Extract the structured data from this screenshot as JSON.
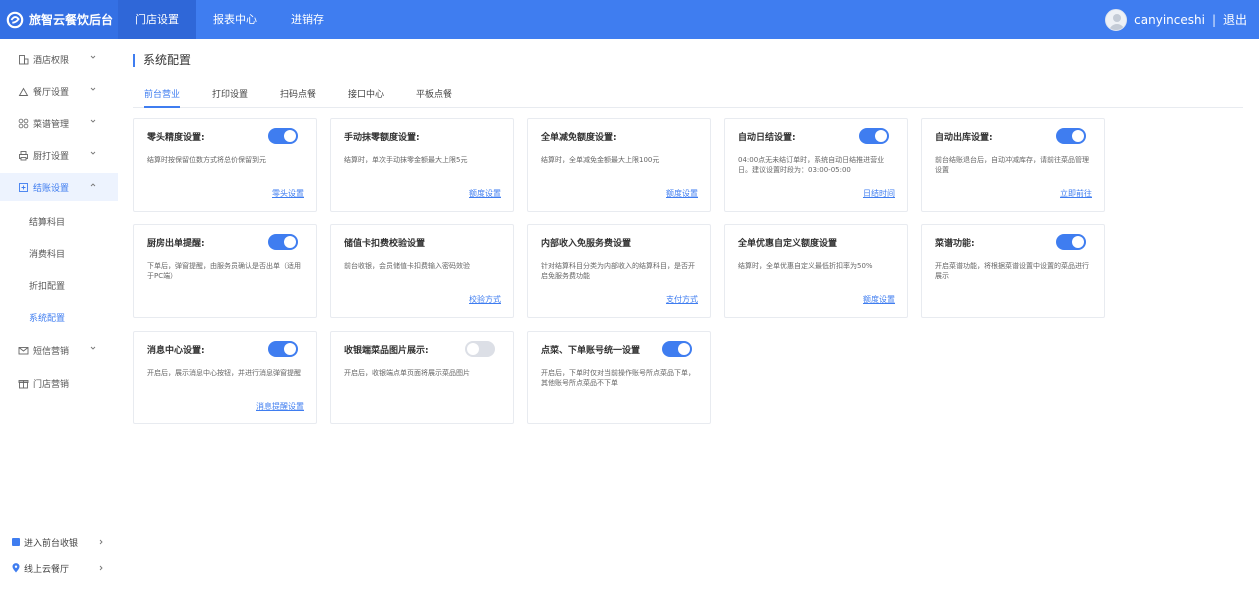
{
  "brand": {
    "name": "旅智云餐饮后台"
  },
  "top_nav": [
    "门店设置",
    "报表中心",
    "进销存"
  ],
  "user": {
    "name": "canyinceshi",
    "separator": "|",
    "logout": "退出"
  },
  "sidebar": {
    "groups": [
      {
        "label": "酒店权限",
        "icon": "building-icon"
      },
      {
        "label": "餐厅设置",
        "icon": "home-icon"
      },
      {
        "label": "菜谱管理",
        "icon": "grid-icon"
      },
      {
        "label": "厨打设置",
        "icon": "printer-icon"
      },
      {
        "label": "结账设置",
        "icon": "checkout-icon"
      }
    ],
    "sub_items": [
      "结算科目",
      "消费科目",
      "折扣配置",
      "系统配置"
    ],
    "groups2": [
      {
        "label": "短信营销",
        "icon": "mail-icon"
      },
      {
        "label": "门店营销",
        "icon": "gift-icon"
      }
    ],
    "bottom": [
      {
        "label": "进入前台收银",
        "icon": "cashier-icon"
      },
      {
        "label": "线上云餐厅",
        "icon": "location-icon"
      }
    ]
  },
  "page": {
    "title": "系统配置"
  },
  "tabs": [
    "前台营业",
    "打印设置",
    "扫码点餐",
    "接口中心",
    "平板点餐"
  ],
  "cards": [
    {
      "title": "零头精度设置:",
      "toggle": true,
      "desc": "结算时按保留位数方式将总价保留到元",
      "link": "零头设置"
    },
    {
      "title": "手动抹零额度设置:",
      "desc": "结算时，单次手动抹零金额最大上限5元",
      "link": "额度设置"
    },
    {
      "title": "全单减免额度设置:",
      "desc": "结算时，全单减免金额最大上限100元",
      "link": "额度设置"
    },
    {
      "title": "自动日结设置:",
      "toggle": true,
      "desc": "04:00点无未结订单时，系统自动日结推进营业日。建议设置时段为：03:00-05:00",
      "link": "日结时间"
    },
    {
      "title": "自动出库设置:",
      "toggle": true,
      "desc": "前台结账退台后，自动冲减库存，请前往菜品管理设置",
      "link": "立即前往"
    },
    {
      "title": "厨房出单提醒:",
      "toggle": true,
      "desc": "下单后，弹窗提醒，由服务员确认是否出单（适用于PC端）"
    },
    {
      "title": "储值卡扣费校验设置",
      "desc": "前台收银，会员储值卡扣费输入密码效验",
      "link": "校验方式"
    },
    {
      "title": "内部收入免服务费设置",
      "desc": "针对结算科目分类为内部收入的结算科目，是否开启免服务费功能",
      "link": "支付方式"
    },
    {
      "title": "全单优惠自定义额度设置",
      "desc": "结算时，全单优惠自定义最低折扣率为50%",
      "link": "额度设置"
    },
    {
      "title": "菜谱功能:",
      "toggle": true,
      "desc": "开启菜谱功能，将根据菜谱设置中设置的菜品进行展示"
    },
    {
      "title": "消息中心设置:",
      "toggle": true,
      "desc": "开启后，展示消息中心按钮，并进行消息弹窗提醒",
      "link": "消息提醒设置"
    },
    {
      "title": "收银端菜品图片展示:",
      "toggle": false,
      "desc": "开启后，收银端点单页面将展示菜品图片"
    },
    {
      "title": "点菜、下单账号统一设置",
      "toggle": true,
      "desc": "开启后，下单时仅对当前操作账号所点菜品下单，其他账号所点菜品不下单"
    }
  ],
  "colors": {
    "primary": "#3f7df0",
    "brand_bg": "#3470e4",
    "active_nav": "#2f67d8"
  }
}
